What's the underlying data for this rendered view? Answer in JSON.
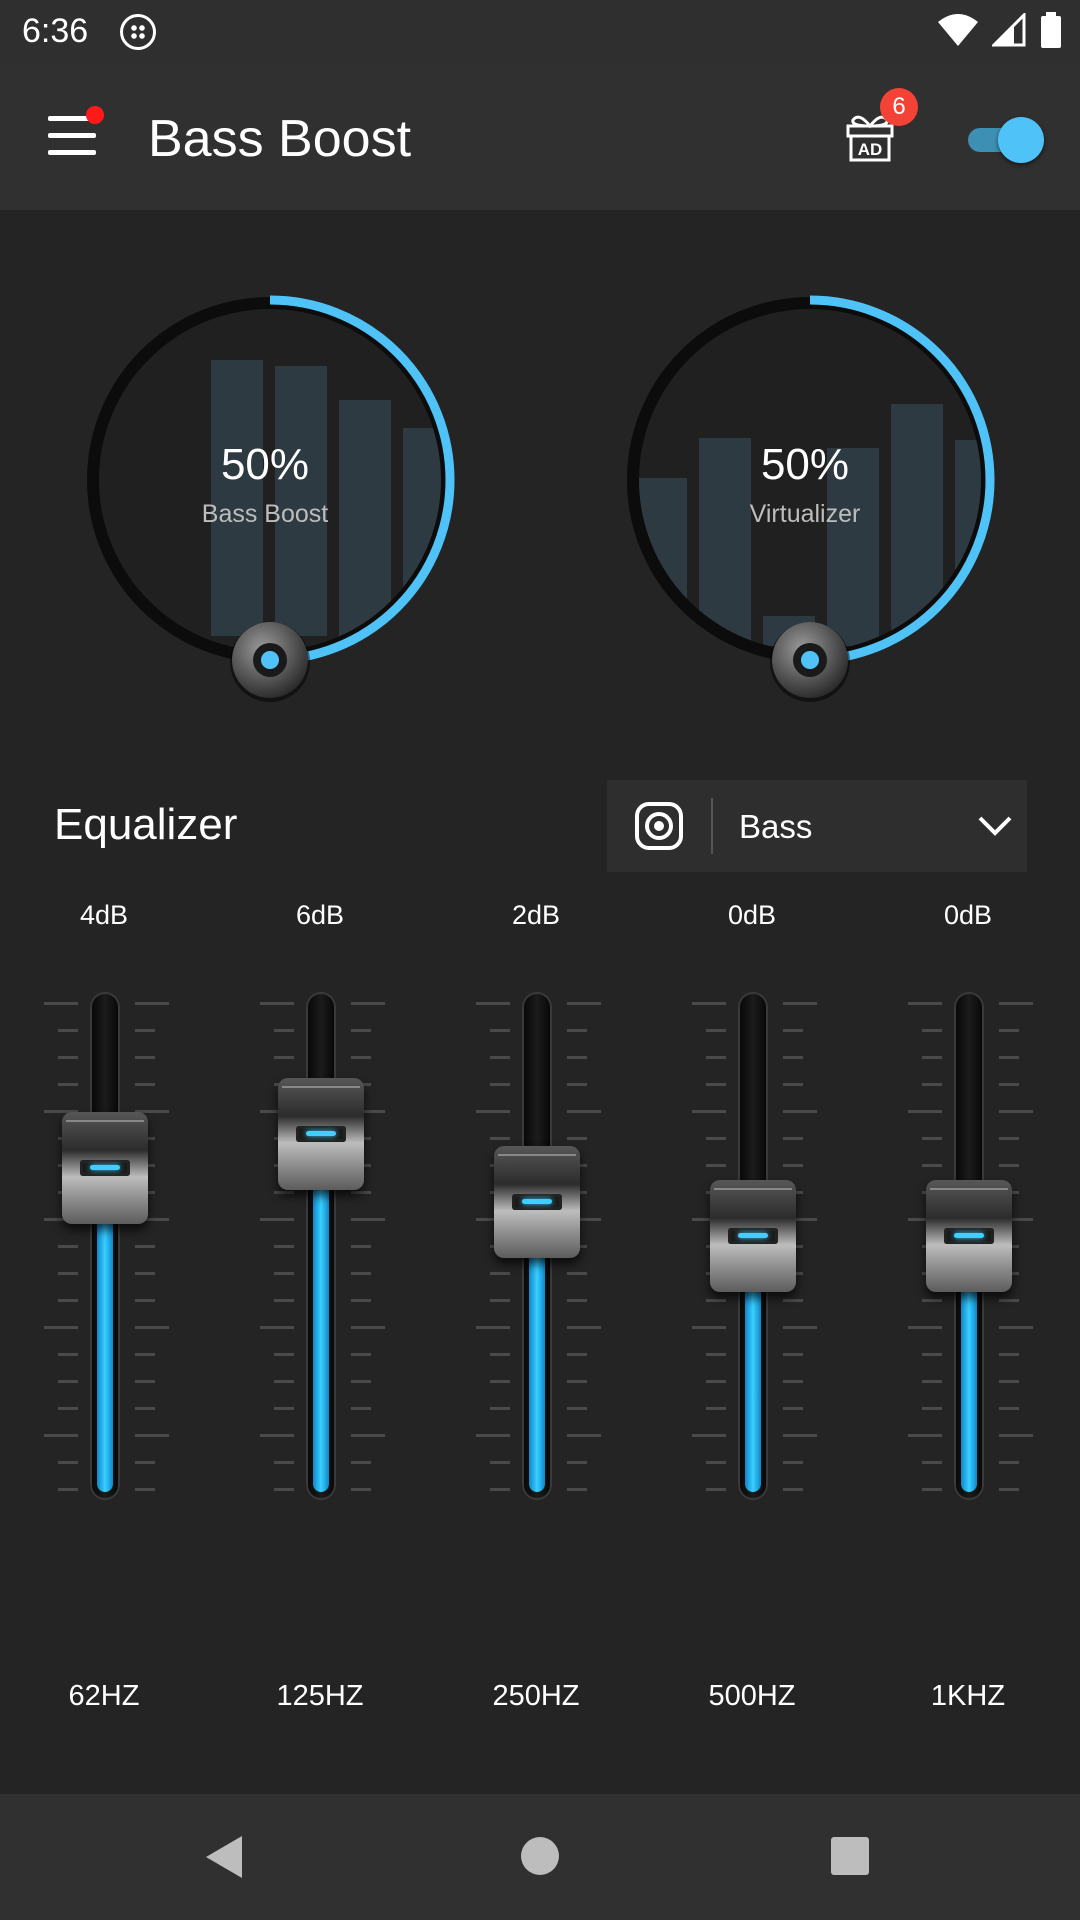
{
  "status_bar": {
    "time": "6:36",
    "icons": [
      "app-badge-icon",
      "wifi-icon",
      "signal-icon",
      "battery-icon"
    ]
  },
  "app_bar": {
    "title": "Bass Boost",
    "ad_badge_count": "6",
    "ad_label": "AD",
    "power_on": true
  },
  "knobs": [
    {
      "value": "50%",
      "label": "Bass Boost",
      "level": 0.5
    },
    {
      "value": "50%",
      "label": "Virtualizer",
      "level": 0.5
    }
  ],
  "equalizer": {
    "title": "Equalizer",
    "preset": "Bass",
    "bands": [
      {
        "gain": "4dB",
        "freq": "62HZ",
        "level": 0.66
      },
      {
        "gain": "6dB",
        "freq": "125HZ",
        "level": 0.73
      },
      {
        "gain": "2dB",
        "freq": "250HZ",
        "level": 0.59
      },
      {
        "gain": "0dB",
        "freq": "500HZ",
        "level": 0.52
      },
      {
        "gain": "0dB",
        "freq": "1KHZ",
        "level": 0.52
      }
    ]
  },
  "colors": {
    "accent": "#4fc3f7",
    "background": "#242424",
    "app_bar": "#303030",
    "badge": "#f44336"
  },
  "nav_bar": {
    "icons": [
      "back-icon",
      "home-icon",
      "recents-icon"
    ]
  }
}
